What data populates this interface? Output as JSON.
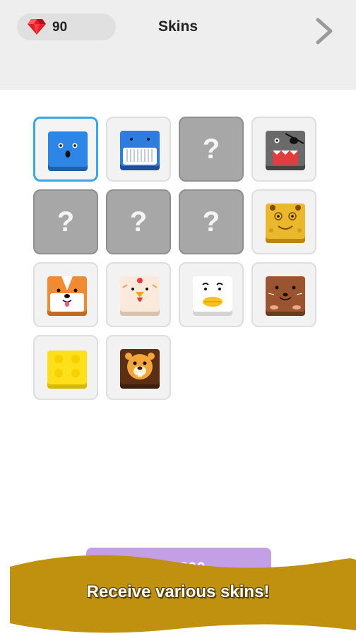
{
  "header": {
    "gem_count": "90",
    "title": "Skins",
    "gem_icon": "ruby-gem-icon",
    "next_icon": "chevron-right-icon"
  },
  "skins": [
    {
      "id": "blue-face",
      "state": "selected",
      "label": ""
    },
    {
      "id": "whale",
      "state": "unlocked",
      "label": ""
    },
    {
      "id": "locked-1",
      "state": "locked",
      "label": "?"
    },
    {
      "id": "pirate",
      "state": "unlocked",
      "label": ""
    },
    {
      "id": "locked-2",
      "state": "locked",
      "label": "?"
    },
    {
      "id": "locked-3",
      "state": "locked",
      "label": "?"
    },
    {
      "id": "locked-4",
      "state": "locked",
      "label": "?"
    },
    {
      "id": "giraffe",
      "state": "unlocked",
      "label": ""
    },
    {
      "id": "corgi",
      "state": "unlocked",
      "label": ""
    },
    {
      "id": "chicken",
      "state": "unlocked",
      "label": ""
    },
    {
      "id": "duck",
      "state": "unlocked",
      "label": ""
    },
    {
      "id": "otter",
      "state": "unlocked",
      "label": ""
    },
    {
      "id": "lego",
      "state": "unlocked",
      "label": ""
    },
    {
      "id": "lion",
      "state": "unlocked",
      "label": ""
    }
  ],
  "buy_button": {
    "price": "300"
  },
  "banner": {
    "text": "Receive various skins!"
  },
  "colors": {
    "header_bg": "#eeeeee",
    "selected_border": "#39a7e4",
    "locked_tile": "#a7a7a7",
    "buy_button": "#c39fe6",
    "banner": "#c0910f"
  }
}
